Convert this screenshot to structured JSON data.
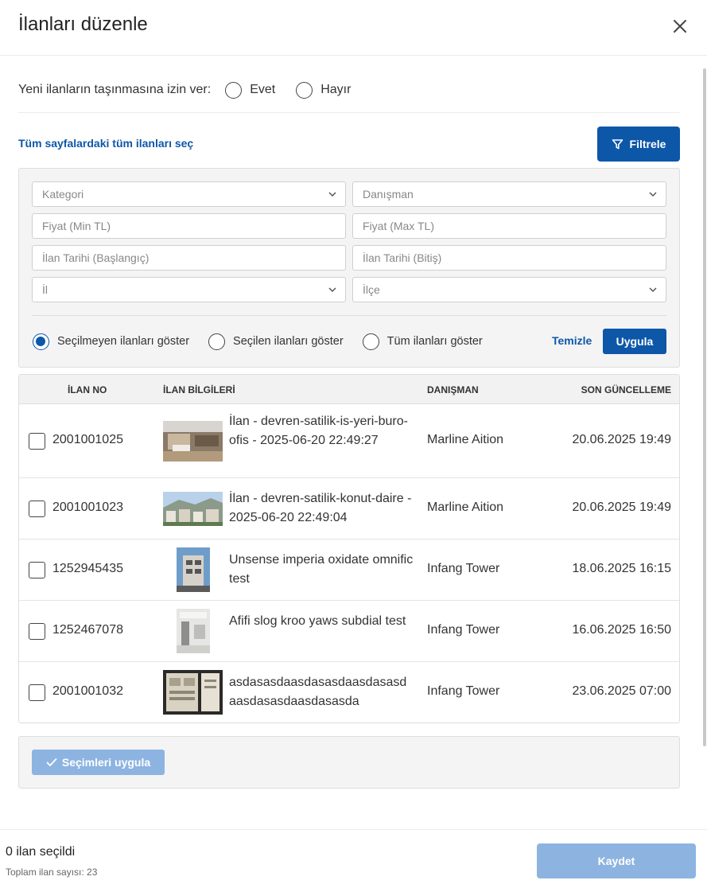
{
  "modal": {
    "title": "İlanları düzenle"
  },
  "migrate": {
    "label": "Yeni ilanların taşınmasına izin ver:",
    "options": [
      {
        "label": "Evet",
        "checked": false
      },
      {
        "label": "Hayır",
        "checked": false
      }
    ]
  },
  "toolbar": {
    "select_all_label": "Tüm sayfalardaki tüm ilanları seç",
    "filter_label": "Filtrele"
  },
  "filters": {
    "category_placeholder": "Kategori",
    "advisor_placeholder": "Danışman",
    "price_min_placeholder": "Fiyat (Min TL)",
    "price_max_placeholder": "Fiyat (Max TL)",
    "date_start_placeholder": "İlan Tarihi (Başlangıç)",
    "date_end_placeholder": "İlan Tarihi (Bitiş)",
    "province_placeholder": "İl",
    "district_placeholder": "İlçe",
    "show_options": [
      {
        "label": "Seçilmeyen ilanları göster",
        "checked": true
      },
      {
        "label": "Seçilen ilanları göster",
        "checked": false
      },
      {
        "label": "Tüm ilanları göster",
        "checked": false
      }
    ],
    "clear_label": "Temizle",
    "apply_label": "Uygula"
  },
  "table": {
    "headers": {
      "no": "İLAN NO",
      "info": "İLAN BİLGİLERİ",
      "advisor": "DANIŞMAN",
      "updated": "SON GÜNCELLEME"
    },
    "rows": [
      {
        "no": "2001001025",
        "info": "İlan - devren-satilik-is-yeri-buro-ofis - 2025-06-20 22:49:27",
        "advisor": "Marline Aition",
        "updated": "20.06.2025 19:49",
        "checked": false
      },
      {
        "no": "2001001023",
        "info": "İlan - devren-satilik-konut-daire - 2025-06-20 22:49:04",
        "advisor": "Marline Aition",
        "updated": "20.06.2025 19:49",
        "checked": false
      },
      {
        "no": "1252945435",
        "info": "Unsense imperia oxidate omnific test",
        "advisor": "Infang Tower",
        "updated": "18.06.2025 16:15",
        "checked": false
      },
      {
        "no": "1252467078",
        "info": "Afifi slog kroo yaws subdial test",
        "advisor": "Infang Tower",
        "updated": "16.06.2025 16:50",
        "checked": false
      },
      {
        "no": "2001001032",
        "info": "asdasasdaasdasasdaasdasasd aasdasasdaasdasasda",
        "advisor": "Infang Tower",
        "updated": "23.06.2025 07:00",
        "checked": false
      }
    ]
  },
  "selection": {
    "apply_label": "Seçimleri uygula"
  },
  "footer": {
    "selected_count": "0 ilan seçildi",
    "total_count": "Toplam ilan sayısı: 23",
    "save_label": "Kaydet"
  },
  "colors": {
    "primary": "#0d57a8",
    "primary_disabled": "#8db4e1"
  }
}
